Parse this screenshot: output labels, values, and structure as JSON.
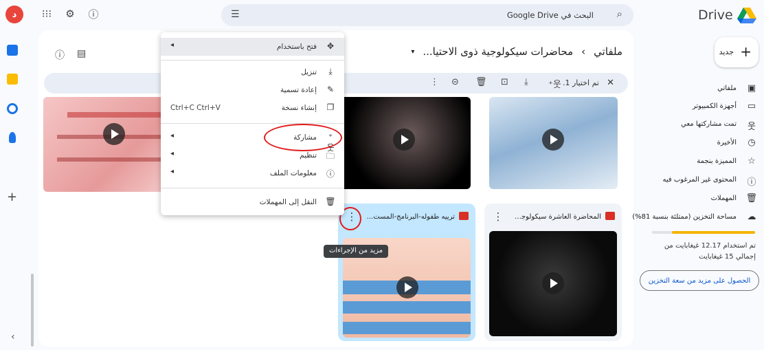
{
  "topbar": {
    "avatar_letter": "د",
    "apps_icon": "apps-grid-icon",
    "settings_icon": "gear-icon",
    "help_icon": "help-circle-icon",
    "search_placeholder": "البحث في Google Drive",
    "product_name": "Drive"
  },
  "sidebar": {
    "new_label": "جديد",
    "items": [
      {
        "label": "ملفاتي",
        "icon": "my-drive-icon"
      },
      {
        "label": "أجهزة الكمبيوتر",
        "icon": "computer-icon"
      },
      {
        "label": "تمت مشاركتها معي",
        "icon": "shared-people-icon"
      },
      {
        "label": "الأخيرة",
        "icon": "clock-icon"
      },
      {
        "label": "المميزة بنجمة",
        "icon": "star-icon"
      },
      {
        "label": "المحتوى غير المرغوب فيه",
        "icon": "spam-icon"
      },
      {
        "label": "المهملات",
        "icon": "trash-icon"
      },
      {
        "label": "مساحة التخزين (ممتلئة بنسبة 81%)",
        "icon": "cloud-icon"
      }
    ],
    "storage_fraction": 0.81,
    "storage_text": "تم استخدام 12.17 غيغابايت من إجمالي 15 غيغابايت",
    "get_more_label": "الحصول على مزيد من سعة التخزين"
  },
  "breadcrumb": {
    "root": "ملفاتي",
    "separator": "›",
    "folder": "محاضرات سيكولوجية ذوى الاحتيا..."
  },
  "selection_bar": {
    "count_text": "تم اختيار 1."
  },
  "files": [
    {
      "name": "ترييه طفوله-البرنامج-المست...",
      "selected": true
    },
    {
      "name": "المحاضرة العاشرة سيكولوجي...",
      "selected": false
    }
  ],
  "tooltip": "مزيد من الإجراءات",
  "context_menu": {
    "items": [
      {
        "label": "فتح باستخدام",
        "icon": "open-with-icon",
        "submenu": true
      },
      {
        "label": "تنزيل",
        "icon": "download-icon"
      },
      {
        "label": "إعادة تسمية",
        "icon": "rename-icon"
      },
      {
        "label": "إنشاء نسخة",
        "icon": "copy-icon",
        "shortcut": "Ctrl+C Ctrl+V"
      },
      {
        "label": "مشاركة",
        "icon": "share-icon",
        "submenu": true
      },
      {
        "label": "تنظيم",
        "icon": "organize-icon",
        "submenu": true
      },
      {
        "label": "معلومات الملف",
        "icon": "info-icon",
        "submenu": true
      },
      {
        "label": "النقل إلى المهملات",
        "icon": "trash-icon"
      }
    ]
  },
  "colors": {
    "accent": "#0b57d0",
    "selected_card": "#c2e7ff",
    "annotation_red": "#e01b1b"
  }
}
